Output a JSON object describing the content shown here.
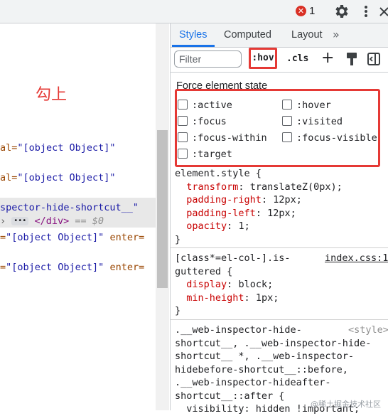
{
  "topbar": {
    "error_icon": "error-circle-icon",
    "error_icon_glyph": "✕",
    "error_count": "1",
    "settings_icon": "gear-icon",
    "more_icon": "kebab-menu-icon"
  },
  "annotation": "勾上",
  "elements": {
    "lines": [
      {
        "prefix": "al=",
        "value": "\"[object Object]\"",
        "suffix": ""
      },
      {
        "prefix": "al=",
        "value": "\"[object Object]\"",
        "suffix": ""
      },
      {
        "prefix": "spector-hide-shortcut__\"",
        "value": "",
        "suffix": ""
      },
      {
        "prefix": "",
        "value": "</div>",
        "suffix": "== $0"
      },
      {
        "prefix": "=",
        "value": "\"[object Object]\"",
        "suffix": " enter="
      },
      {
        "prefix": "=",
        "value": "\"[object Object]\"",
        "suffix": " enter="
      }
    ],
    "ellipsis": "•••"
  },
  "styles": {
    "tabs": [
      "Styles",
      "Computed",
      "Layout"
    ],
    "active_tab": "Styles",
    "more_tabs_glyph": "»",
    "filter_placeholder": "Filter",
    "hov_label": ":hov",
    "cls_label": ".cls",
    "add_glyph": "+",
    "force_state_title": "Force element state",
    "states_left": [
      ":active",
      ":focus",
      ":focus-within",
      ":target"
    ],
    "states_right": [
      ":hover",
      ":visited",
      ":focus-visible"
    ],
    "element_style": {
      "selector": "element.style {",
      "props": [
        {
          "name": "transform",
          "value": "translateZ(0px);"
        },
        {
          "name": "padding-right",
          "value": "12px;"
        },
        {
          "name": "padding-left",
          "value": "12px;"
        },
        {
          "name": "opacity",
          "value": "1;"
        }
      ],
      "close": "}"
    },
    "rule2": {
      "selector_line1": "[class*=el-col-].is-",
      "selector_line2": "guttered {",
      "source": "index.css:1",
      "props": [
        {
          "name": "display",
          "value": "block;"
        },
        {
          "name": "min-height",
          "value": "1px;"
        }
      ],
      "close": "}"
    },
    "rule3": {
      "lines": [
        ".__web-inspector-hide-",
        "shortcut__, .__web-inspector-hide-",
        "shortcut__ *, .__web-inspector-",
        "hidebefore-shortcut__::before,",
        ".__web-inspector-hideafter-",
        "shortcut__::after {"
      ],
      "source": "<style>",
      "partial_prop": "visibility: hidden !important;"
    }
  },
  "watermark": "@稀土掘金技术社区",
  "colors": {
    "accent": "#1a73e8",
    "highlight_border": "#e53935",
    "property_name": "#c80000",
    "attr_value": "#1a1aa6"
  }
}
